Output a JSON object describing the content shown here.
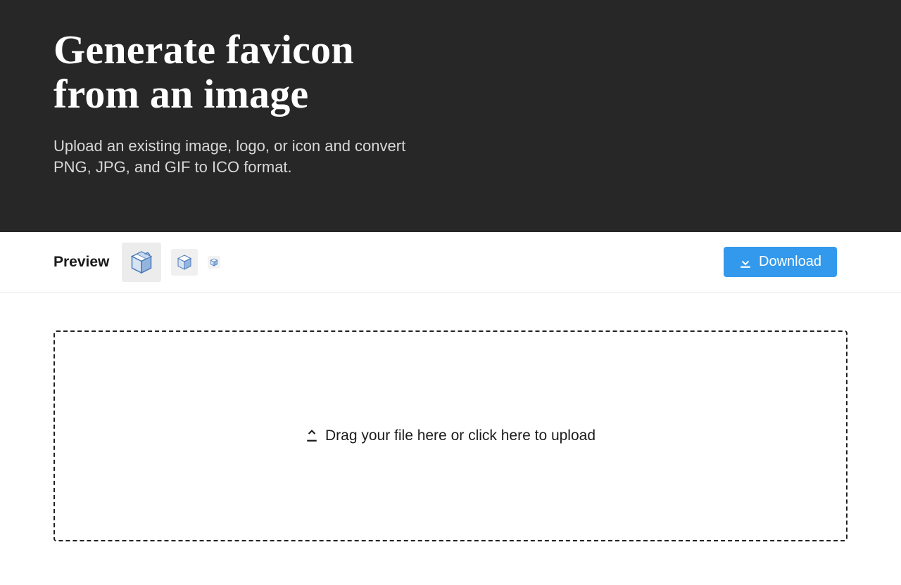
{
  "hero": {
    "title_line1": "Generate favicon",
    "title_line2": "from an image",
    "subtitle": "Upload an existing image, logo, or icon and convert PNG, JPG, and GIF to ICO format."
  },
  "preview": {
    "label": "Preview"
  },
  "actions": {
    "download_label": "Download"
  },
  "dropzone": {
    "text": "Drag your file here or click here to upload"
  }
}
